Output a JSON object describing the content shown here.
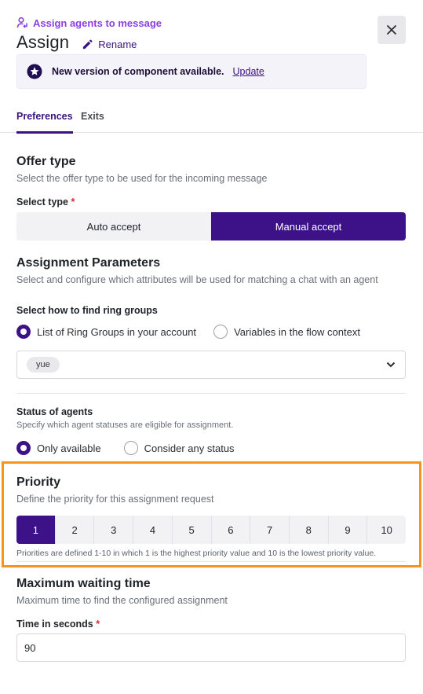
{
  "header": {
    "breadcrumb": "Assign agents to message",
    "breadcrumb_icon": "user-assign-icon",
    "title": "Assign",
    "rename_label": "Rename",
    "close_icon": "close-icon"
  },
  "banner": {
    "icon": "star-badge-icon",
    "text": "New version of component available.",
    "link": "Update"
  },
  "tabs": [
    {
      "label": "Preferences",
      "active": true
    },
    {
      "label": "Exits",
      "active": false
    }
  ],
  "offer_type": {
    "title": "Offer type",
    "description": "Select the offer type to be used for the incoming message",
    "field_label": "Select type",
    "required_mark": "*",
    "options": [
      {
        "label": "Auto accept",
        "selected": false
      },
      {
        "label": "Manual accept",
        "selected": true
      }
    ]
  },
  "assignment": {
    "title": "Assignment Parameters",
    "description": "Select and configure which attributes will be used for matching a chat with an agent",
    "ring_groups_label": "Select how to find ring groups",
    "ring_group_options": [
      {
        "label": "List of Ring Groups in your account",
        "selected": true
      },
      {
        "label": "Variables in the flow context",
        "selected": false
      }
    ],
    "selected_ring_groups": [
      "yue"
    ],
    "status_label": "Status of agents",
    "status_description": "Specify which agent statuses are eligible for assignment.",
    "status_options": [
      {
        "label": "Only available",
        "selected": true
      },
      {
        "label": "Consider any status",
        "selected": false
      }
    ]
  },
  "priority": {
    "title": "Priority",
    "description": "Define the priority for this assignment request",
    "options": [
      "1",
      "2",
      "3",
      "4",
      "5",
      "6",
      "7",
      "8",
      "9",
      "10"
    ],
    "selected": "1",
    "note": "Priorities are defined 1-10 in which 1 is the highest priority value and 10 is the lowest priority value."
  },
  "waiting": {
    "title": "Maximum waiting time",
    "description": "Maximum time to find the configured assignment",
    "field_label": "Time in seconds",
    "required_mark": "*",
    "value": "90"
  },
  "colors": {
    "accent": "#3d1188",
    "breadcrumb": "#8a3fe0",
    "highlight": "#f7941d",
    "required": "#d6283a"
  }
}
